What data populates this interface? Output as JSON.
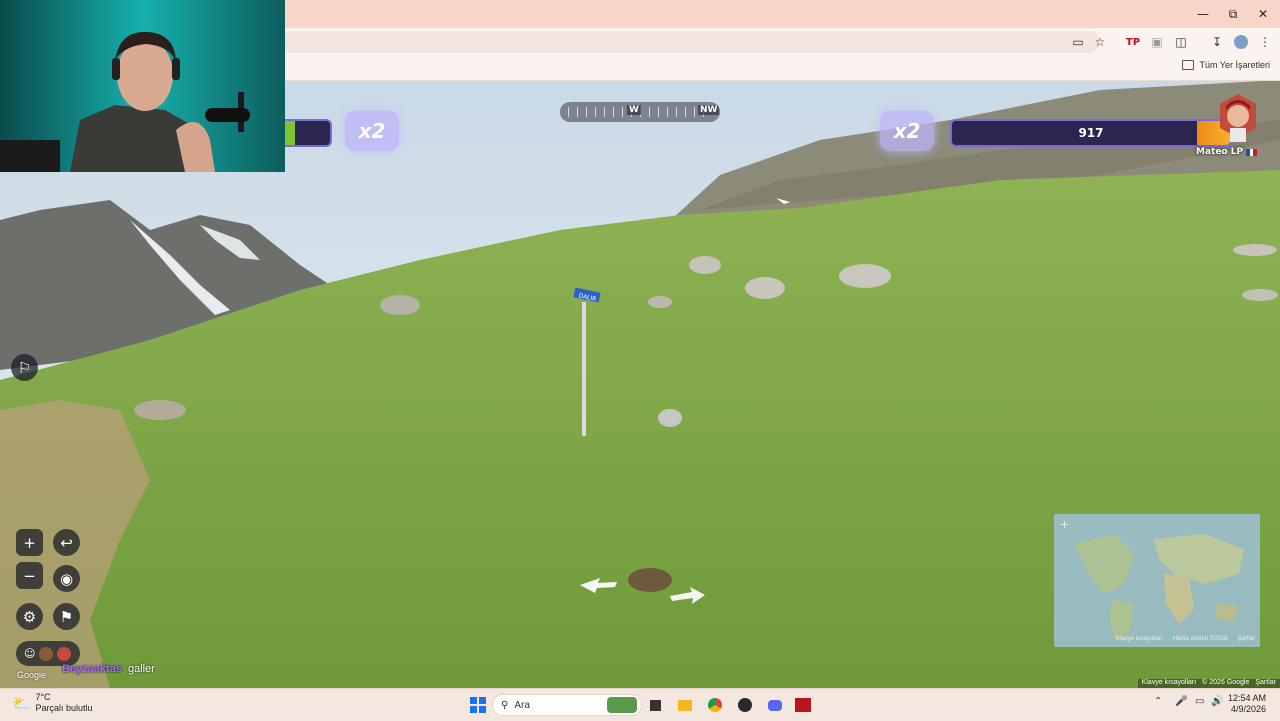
{
  "browser": {
    "bookmarks_folder": "Tüm Yer İşaretleri",
    "window_controls": [
      "minimize",
      "restore",
      "close"
    ]
  },
  "hud": {
    "left_multiplier": "x2",
    "right_multiplier": "x2",
    "right_health": "917",
    "right_health_fraction": 0.12,
    "player_name": "Mateo LP",
    "compass_labels": [
      "W",
      "NW"
    ]
  },
  "scene": {
    "sign_text": "DALIR"
  },
  "chat": {
    "user": "Beyzaaktas",
    "message": "galler"
  },
  "map": {
    "attribution": [
      "Klavye kısayolları",
      "© 2026 Google",
      "Şartlar"
    ],
    "minimap_labels": [
      "Klavye kısayolları",
      "Harita verileri ©2026",
      "Şartlar"
    ]
  },
  "google_logo": "Google",
  "taskbar": {
    "weather_temp": "7°C",
    "weather_desc": "Parçalı bulutlu",
    "search_placeholder": "Ara",
    "time": "12:54 AM",
    "date": "4/9/2026"
  }
}
